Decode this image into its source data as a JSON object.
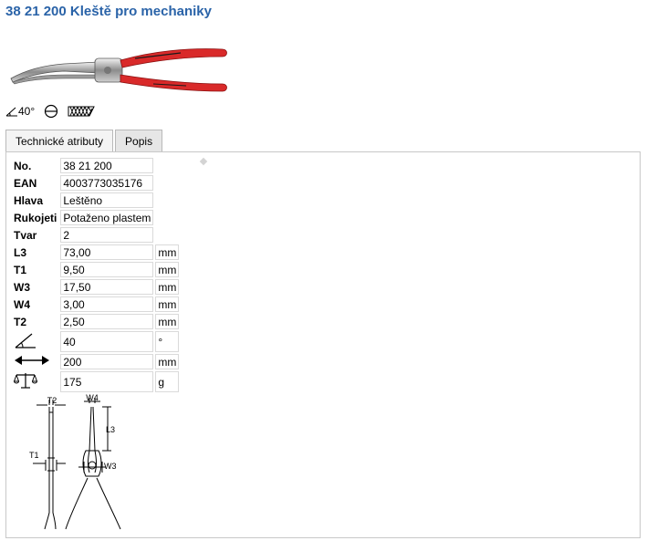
{
  "page": {
    "title": "38 21 200 Kleště pro mechaniky"
  },
  "symbols": {
    "angle_label": "40°"
  },
  "tabs": [
    {
      "label": "Technické atributy",
      "active": true
    },
    {
      "label": "Popis",
      "active": false
    }
  ],
  "attributes": [
    {
      "label": "No.",
      "value": "38 21 200",
      "unit": ""
    },
    {
      "label": "EAN",
      "value": "4003773035176",
      "unit": ""
    },
    {
      "label": "Hlava",
      "value": "Leštěno",
      "unit": ""
    },
    {
      "label": "Rukojeti",
      "value": "Potaženo plastem",
      "unit": ""
    },
    {
      "label": "Tvar",
      "value": "2",
      "unit": ""
    },
    {
      "label": "L3",
      "value": "73,00",
      "unit": "mm"
    },
    {
      "label": "T1",
      "value": "9,50",
      "unit": "mm"
    },
    {
      "label": "W3",
      "value": "17,50",
      "unit": "mm"
    },
    {
      "label": "W4",
      "value": "3,00",
      "unit": "mm"
    },
    {
      "label": "T2",
      "value": "2,50",
      "unit": "mm"
    },
    {
      "label_icon": "angle-icon",
      "value": "40",
      "unit": "°"
    },
    {
      "label_icon": "length-arrow-icon",
      "value": "200",
      "unit": "mm"
    },
    {
      "label_icon": "scale-weight-icon",
      "value": "175",
      "unit": "g"
    }
  ],
  "drawing_labels": {
    "t2": "T2",
    "w4": "W4",
    "l3": "L3",
    "t1": "T1",
    "w3": "W3"
  },
  "colors": {
    "title": "#2a63a8",
    "handle": "#d92a2a"
  }
}
